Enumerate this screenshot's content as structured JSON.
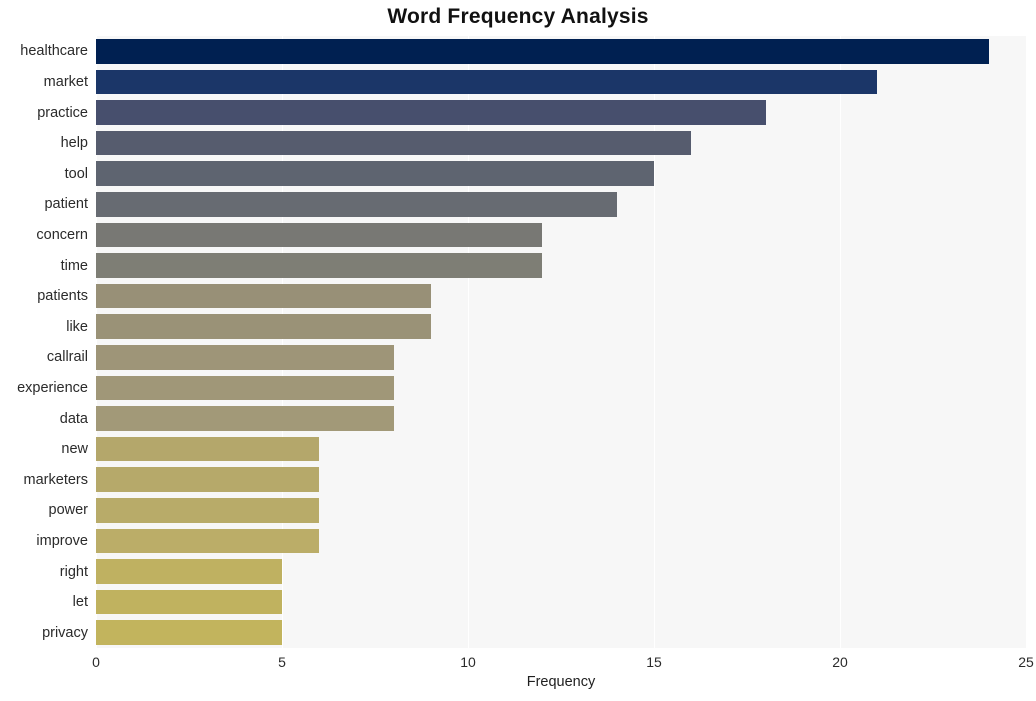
{
  "chart_data": {
    "type": "bar",
    "orientation": "horizontal",
    "title": "Word Frequency Analysis",
    "xlabel": "Frequency",
    "ylabel": "",
    "categories": [
      "healthcare",
      "market",
      "practice",
      "help",
      "tool",
      "patient",
      "concern",
      "time",
      "patients",
      "like",
      "callrail",
      "experience",
      "data",
      "new",
      "marketers",
      "power",
      "improve",
      "right",
      "let",
      "privacy"
    ],
    "values": [
      24,
      21,
      18,
      16,
      15,
      14,
      12,
      12,
      9,
      9,
      8,
      8,
      8,
      6,
      6,
      6,
      6,
      5,
      5,
      5
    ],
    "xlim": [
      0,
      25
    ],
    "xticks": [
      0,
      5,
      10,
      15,
      20,
      25
    ],
    "xtick_labels": [
      "0",
      "5",
      "10",
      "15",
      "20",
      "25"
    ],
    "grid": true,
    "legend": false,
    "colormap": "cividis",
    "bar_colors": [
      "#002051",
      "#1b3668",
      "#474f6d",
      "#565c6e",
      "#5e6470",
      "#676b72",
      "#787874",
      "#7e7e75",
      "#989077",
      "#9a9277",
      "#9e9578",
      "#a09778",
      "#a29978",
      "#b4a76b",
      "#b6a96a",
      "#b8ab69",
      "#bbad68",
      "#bfb161",
      "#c0b25f",
      "#c2b45d"
    ],
    "plot_bgcolor": "#f7f7f7",
    "figure_bgcolor": "#ffffff",
    "gridline_color": "#ffffff"
  }
}
